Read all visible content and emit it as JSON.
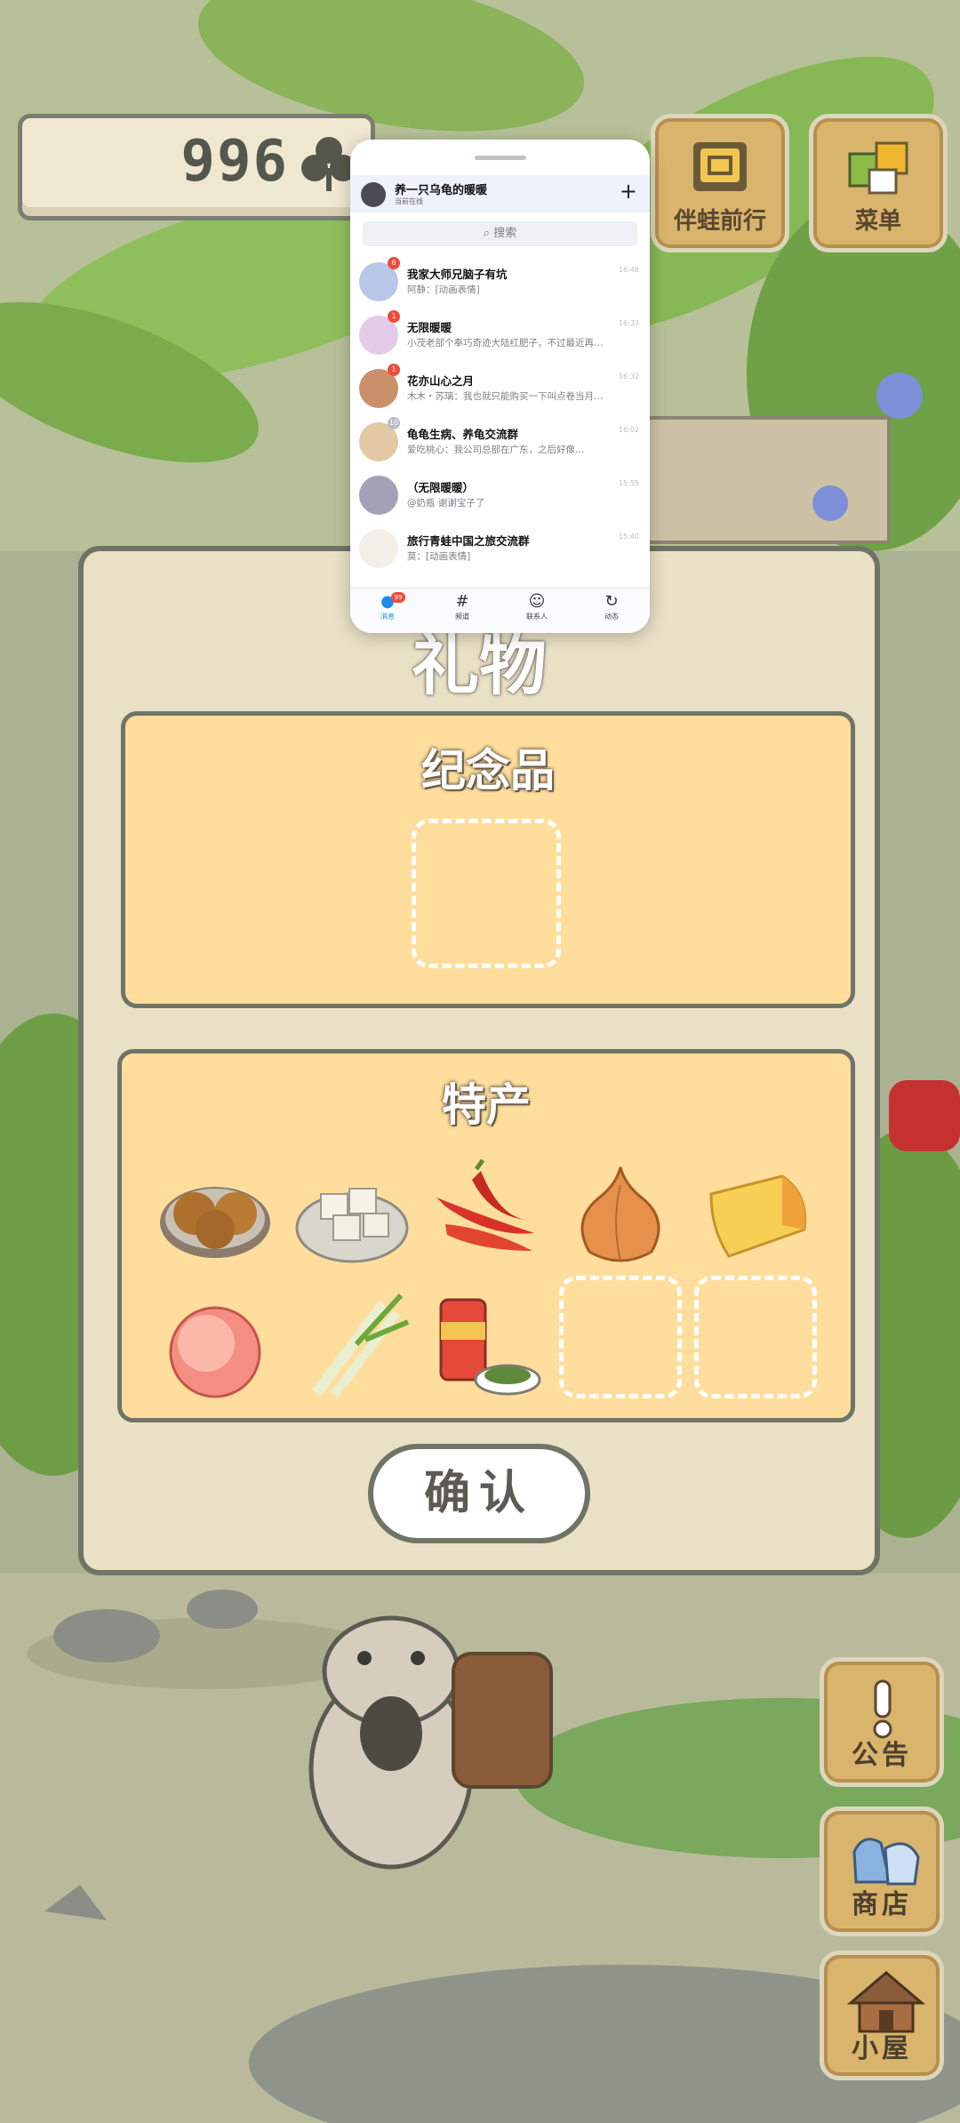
{
  "game": {
    "clover_count": "996",
    "top_buttons": [
      {
        "label": "伴蛙前行"
      },
      {
        "label": "菜单"
      }
    ],
    "panel": {
      "title": "礼物",
      "souvenir_section": {
        "title": "纪念品"
      },
      "specialty_section": {
        "title": "特产",
        "items": [
          "mooncake-icon",
          "tofu-icon",
          "chili-icon",
          "onion-icon",
          "cheese-icon",
          "peach-icon",
          "scallion-icon",
          "tea-can-icon"
        ]
      },
      "confirm_label": "确认"
    },
    "side_buttons": [
      {
        "label": "公告"
      },
      {
        "label": "商店"
      },
      {
        "label": "小屋"
      }
    ]
  },
  "chat": {
    "header_name": "养一只乌龟的暖暖",
    "header_status": "当前在线",
    "plus_icon": "+",
    "search_placeholder": "搜索",
    "rows": [
      {
        "title": "我家大师兄脑子有坑",
        "preview": "阿静：[动画表情]",
        "time": "16:48",
        "badge": "6"
      },
      {
        "title": "无限暖暖",
        "preview": "小茂老部个奉巧奇迹大陆红肥子，不过最近再…",
        "time": "16:33",
        "badge": "1"
      },
      {
        "title": "花亦山心之月",
        "preview": "木木・苏璃：我也就只能购买一下叫点卷当月…",
        "time": "16:32",
        "badge": "1"
      },
      {
        "title": "龟龟生病、养龟交流群",
        "preview": "爱吃桃心：我公司总部在广东，之后好像…",
        "time": "16:02",
        "badge": "10"
      },
      {
        "title": "（无限暖暖）",
        "preview": "@奶瓶 谢谢宝子了",
        "time": "15:55",
        "badge": ""
      },
      {
        "title": "旅行青蛙中国之旅交流群",
        "preview": "莫：[动画表情]",
        "time": "15:40",
        "badge": ""
      }
    ],
    "tabs": [
      {
        "label": "消息",
        "icon": "message-icon",
        "badge": "99"
      },
      {
        "label": "频道",
        "icon": "hash-icon"
      },
      {
        "label": "联系人",
        "icon": "contact-icon"
      },
      {
        "label": "动态",
        "icon": "refresh-icon"
      }
    ]
  }
}
